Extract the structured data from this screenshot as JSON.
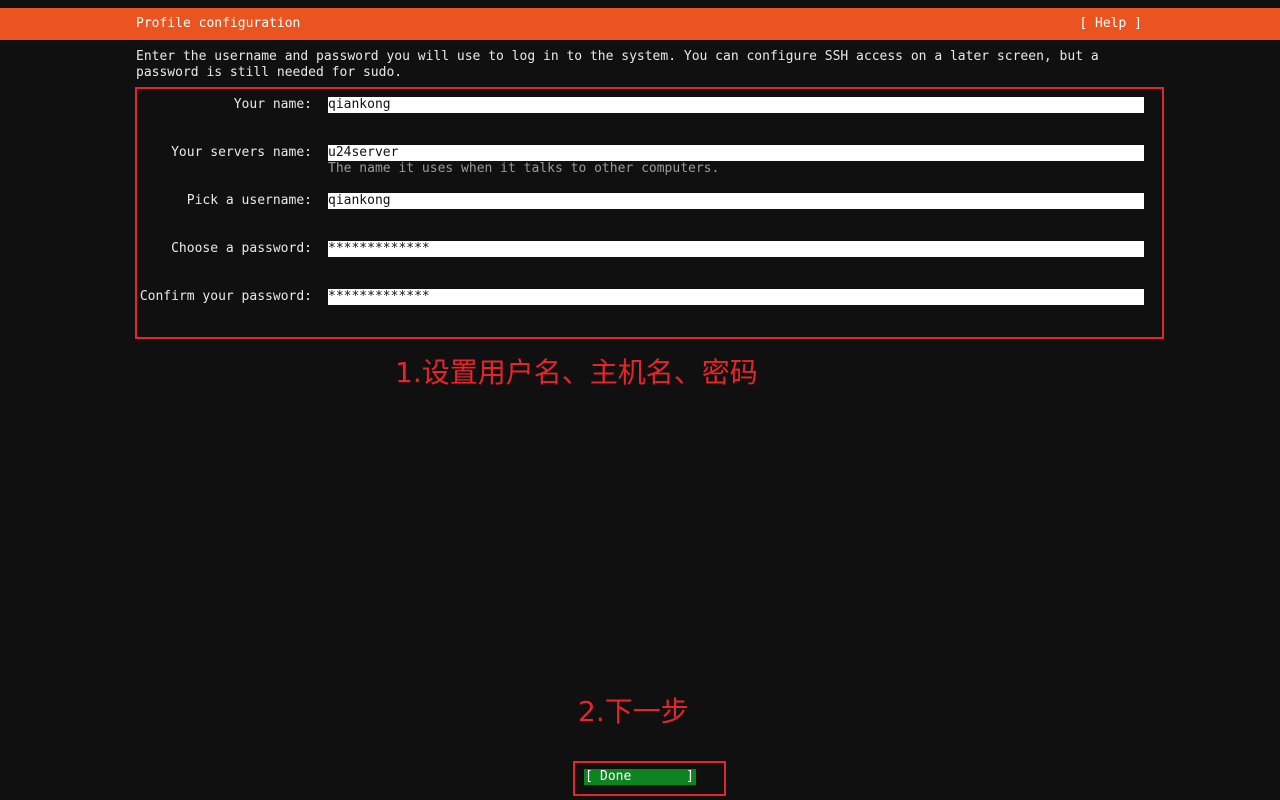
{
  "header": {
    "title": "Profile configuration",
    "help_label": "[ Help ]"
  },
  "intro": "Enter the username and password you will use to log in to the system. You can configure SSH access on a later screen, but a password is still needed for sudo.",
  "form": {
    "your_name": {
      "label": "Your name:",
      "value": "qiankong"
    },
    "server_name": {
      "label": "Your servers name:",
      "value": "u24server",
      "hint": "The name it uses when it talks to other computers."
    },
    "username": {
      "label": "Pick a username:",
      "value": "qiankong"
    },
    "password": {
      "label": "Choose a password:",
      "value": "*************"
    },
    "confirm_password": {
      "label": "Confirm your password:",
      "value": "*************"
    }
  },
  "annotations": {
    "step1": "1.设置用户名、主机名、密码",
    "step2": "2.下一步"
  },
  "done_button": {
    "left_bracket": "[",
    "label": "Done",
    "right_bracket": "]"
  },
  "colors": {
    "header_bg": "#e95420",
    "annotation_red": "#e4252a",
    "button_green": "#0e8420",
    "background": "#101010"
  }
}
